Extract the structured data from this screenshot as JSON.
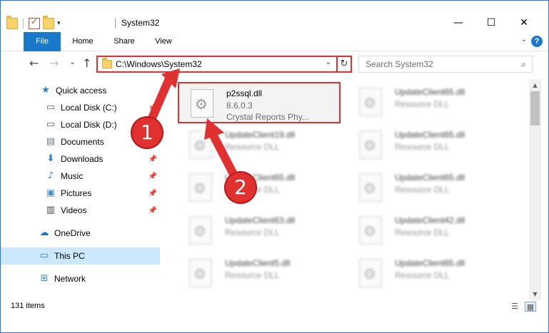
{
  "window": {
    "title": "System32",
    "controls": {
      "minimize": "—",
      "maximize": "☐",
      "close": "✕"
    }
  },
  "ribbon": {
    "tabs": [
      "File",
      "Home",
      "Share",
      "View"
    ],
    "help": "?"
  },
  "nav": {
    "back": "←",
    "forward": "→",
    "recent": "⌄",
    "up": "↑",
    "address": "C:\\Windows\\System32",
    "refresh": "↻",
    "search_placeholder": "Search System32",
    "search_icon": "search-icon"
  },
  "sidebar": {
    "items": [
      {
        "label": "Quick access",
        "icon": "★",
        "icon_name": "star-icon",
        "pinned": false
      },
      {
        "label": "Local Disk (C:)",
        "icon": "▭",
        "icon_name": "drive-icon",
        "pinned": true
      },
      {
        "label": "Local Disk (D:)",
        "icon": "▭",
        "icon_name": "drive-icon",
        "pinned": true
      },
      {
        "label": "Documents",
        "icon": "▤",
        "icon_name": "documents-icon",
        "pinned": true
      },
      {
        "label": "Downloads",
        "icon": "⬇",
        "icon_name": "download-icon",
        "pinned": true
      },
      {
        "label": "Music",
        "icon": "♪",
        "icon_name": "music-icon",
        "pinned": true
      },
      {
        "label": "Pictures",
        "icon": "▣",
        "icon_name": "pictures-icon",
        "pinned": true
      },
      {
        "label": "Videos",
        "icon": "▥",
        "icon_name": "videos-icon",
        "pinned": true
      },
      {
        "label": "OneDrive",
        "icon": "☁",
        "icon_name": "onedrive-icon",
        "pinned": false
      },
      {
        "label": "This PC",
        "icon": "▭",
        "icon_name": "computer-icon",
        "pinned": false
      },
      {
        "label": "Network",
        "icon": "⊞",
        "icon_name": "network-icon",
        "pinned": false
      }
    ],
    "pin_glyph": "📌"
  },
  "files": {
    "highlighted": {
      "name": "p2ssql.dll",
      "version": "8.6.0.3",
      "description": "Crystal Reports Phy..."
    },
    "blurred": [
      {
        "name": "UpdateClient65.dll",
        "type": "Resource DLL"
      },
      {
        "name": "UpdateClient19.dll",
        "type": "Resource DLL"
      },
      {
        "name": "UpdateClient65.dll",
        "type": "Resource DLL"
      },
      {
        "name": "UpdateClient65.dll",
        "type": "Resource DLL"
      },
      {
        "name": "UpdateClient65.dll",
        "type": "Resource DLL"
      },
      {
        "name": "UpdateClient63.dll",
        "type": "Resource DLL"
      },
      {
        "name": "UpdateClient42.dll",
        "type": "Resource DLL"
      },
      {
        "name": "UpdateClient5.dll",
        "type": "Resource DLL"
      },
      {
        "name": "UpdateClient65.dll",
        "type": "Resource DLL"
      }
    ]
  },
  "status": {
    "count": "131 items"
  },
  "callouts": {
    "one": "1",
    "two": "2"
  },
  "colors": {
    "accent": "#1979ca",
    "highlight_red": "#e03030",
    "selected_bg": "#cce8ff"
  }
}
